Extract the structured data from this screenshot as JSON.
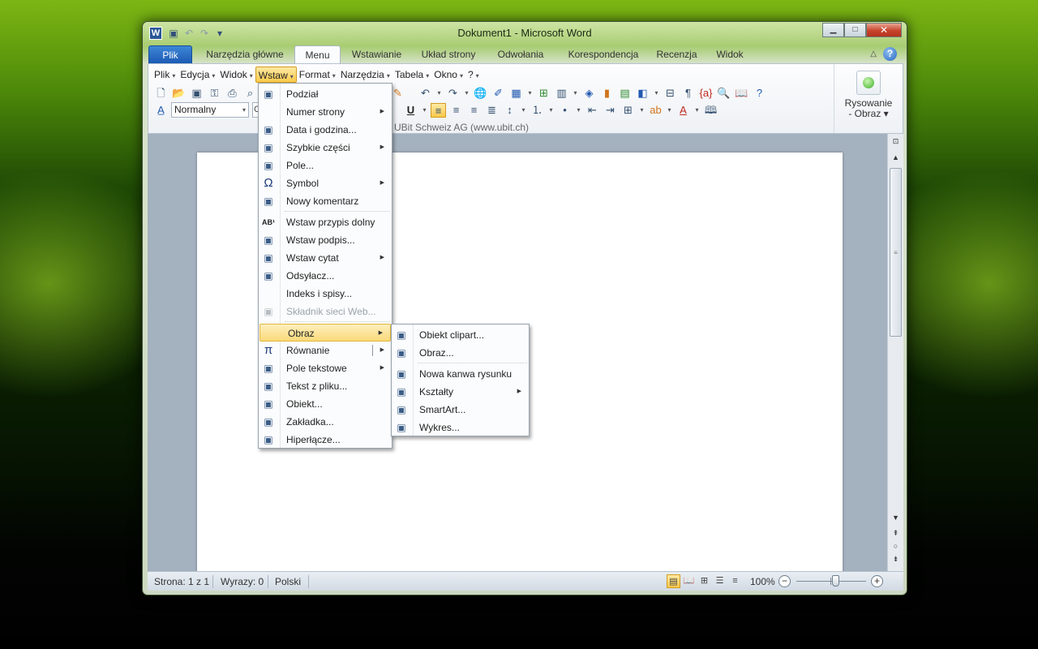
{
  "window": {
    "title": "Dokument1 - Microsoft Word"
  },
  "quick_access": [
    "save-icon",
    "undo-icon",
    "redo-icon",
    "customize-qat-icon"
  ],
  "tabs": [
    "Plik",
    "Narzędzia główne",
    "Menu",
    "Wstawianie",
    "Układ strony",
    "Odwołania",
    "Korespondencja",
    "Recenzja",
    "Widok"
  ],
  "active_tab": "Menu",
  "menubar": [
    "Plik",
    "Edycja",
    "Widok",
    "Wstaw",
    "Format",
    "Narzędzia",
    "Tabela",
    "Okno",
    "?"
  ],
  "toolbar": {
    "style_value": "Normalny",
    "font_stub": "C",
    "group_label": "UBit Schweiz AG   (www.ubit.ch)",
    "drawing_label_1": "Rysowanie",
    "drawing_label_2": "- Obraz",
    "underline": "U",
    "font_color": "A"
  },
  "insert_menu": [
    {
      "label": "Podział",
      "icon": "page-break-icon"
    },
    {
      "label": "Numer strony",
      "icon": "",
      "submenu": true
    },
    {
      "label": "Data i godzina...",
      "icon": "date-time-icon"
    },
    {
      "label": "Szybkie części",
      "icon": "quick-parts-icon",
      "submenu": true
    },
    {
      "label": "Pole...",
      "icon": "field-icon"
    },
    {
      "label": "Symbol",
      "icon": "omega-icon",
      "glyph": "Ω",
      "submenu": true
    },
    {
      "label": "Nowy komentarz",
      "icon": "comment-icon"
    },
    {
      "label": "Wstaw przypis dolny",
      "icon": "footnote-icon",
      "glyph": "AB¹"
    },
    {
      "label": "Wstaw podpis...",
      "icon": "caption-icon"
    },
    {
      "label": "Wstaw cytat",
      "icon": "citation-icon",
      "submenu": true
    },
    {
      "label": "Odsyłacz...",
      "icon": "cross-reference-icon"
    },
    {
      "label": "Indeks i spisy...",
      "icon": ""
    },
    {
      "label": "Składnik sieci Web...",
      "icon": "web-component-icon",
      "disabled": true
    },
    {
      "label": "Obraz",
      "icon": "",
      "submenu": true,
      "highlighted": true
    },
    {
      "label": "Równanie",
      "icon": "pi-icon",
      "glyph": "π",
      "split": true
    },
    {
      "label": "Pole tekstowe",
      "icon": "text-box-icon",
      "submenu": true
    },
    {
      "label": "Tekst z pliku...",
      "icon": "text-from-file-icon"
    },
    {
      "label": "Obiekt...",
      "icon": "object-icon"
    },
    {
      "label": "Zakładka...",
      "icon": "bookmark-icon"
    },
    {
      "label": "Hiperłącze...",
      "icon": "hyperlink-icon"
    }
  ],
  "picture_submenu": [
    {
      "label": "Obiekt clipart...",
      "icon": "clipart-icon"
    },
    {
      "label": "Obraz...",
      "icon": "picture-icon"
    },
    {
      "label": "Nowa kanwa rysunku",
      "icon": "drawing-canvas-icon"
    },
    {
      "label": "Kształty",
      "icon": "shapes-icon",
      "submenu": true
    },
    {
      "label": "SmartArt...",
      "icon": "smartart-icon"
    },
    {
      "label": "Wykres...",
      "icon": "chart-icon"
    }
  ],
  "statusbar": {
    "page": "Strona: 1 z 1",
    "words": "Wyrazy: 0",
    "language": "Polski",
    "zoom": "100%",
    "zoom_minus": "−",
    "zoom_plus": "+"
  }
}
